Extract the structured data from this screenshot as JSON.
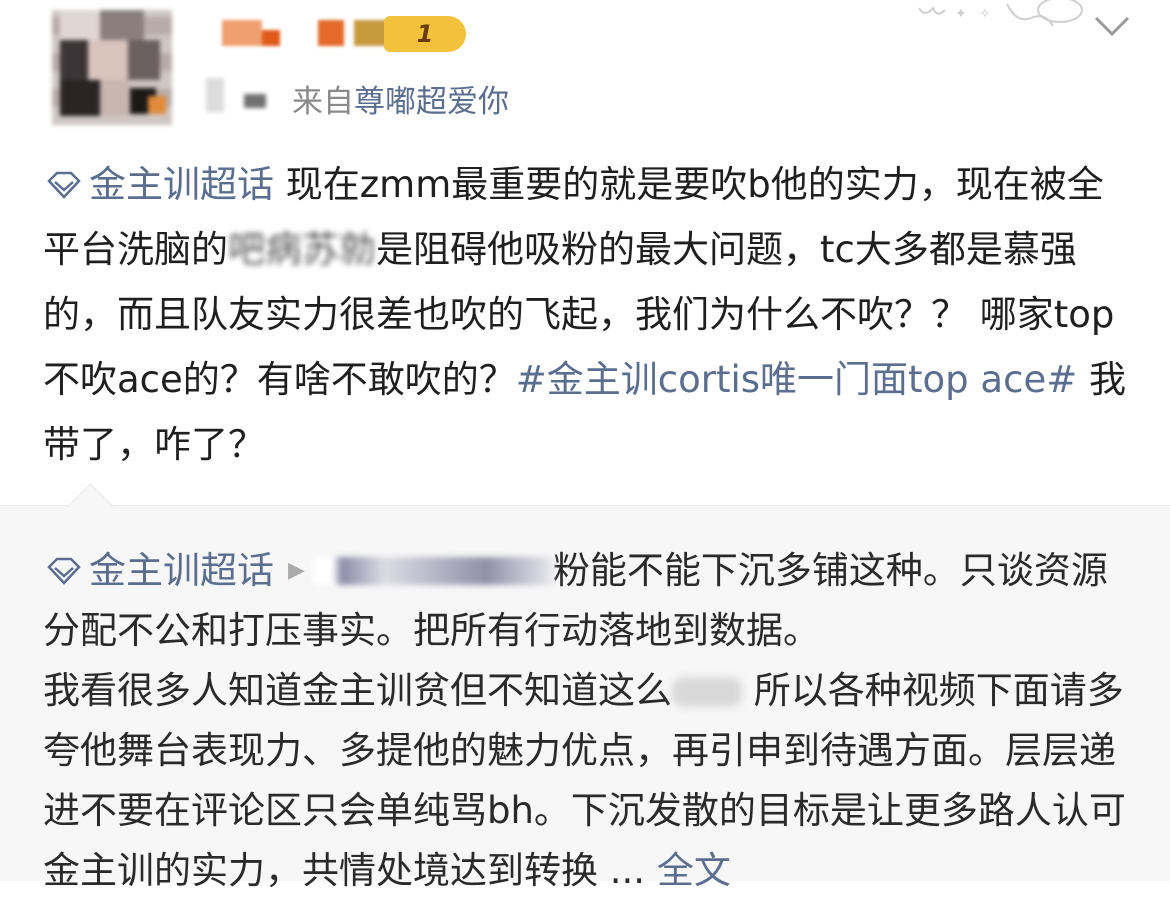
{
  "post": {
    "source_prefix": "来自",
    "source_name": "尊嘟超爱你",
    "badge_text": "1",
    "supertopic": "金主训超话",
    "body": "现在zmm最重要的就是要吹b他的实力，现在被全平台洗脑的",
    "body_blurred": "吧病苏勍",
    "body_rest": "是阻碍他吸粉的最大问题，tc大多都是慕强的，而且队友实力很差也吹的飞起，我们为什么不吹？？ 哪家top不吹ace的？有啥不敢吹的？",
    "hashtag": "#金主训cortis唯一门面top ace#",
    "tail": " 我带了，咋了？"
  },
  "repost": {
    "supertopic": "金主训超话",
    "line1_after_blur": "粉能不能下沉多铺这种。只谈资源分配不公和打压事实。把所有行动落地到数据。",
    "line2_before_blur": "我看很多人知道金主训贫但不知道这么",
    "line2_after_blur": "所以各种视频下面请多夸他舞台表现力、多提他的魅力优点，再引申到待遇方面。层层递进不要在评论区只会单纯骂bh。下沉发散的目标是让更多路人认可金主训的实力，共情处境达到转换",
    "ellipsis": "...",
    "more_label": "全文"
  },
  "icons": {
    "diamond": "supertopic-diamond-icon",
    "chevron": "chevron-down-icon",
    "play": "play-icon"
  },
  "colors": {
    "link": "#5b6e8f",
    "badge": "#f2c23c",
    "repost_bg": "#f7f7f7"
  }
}
